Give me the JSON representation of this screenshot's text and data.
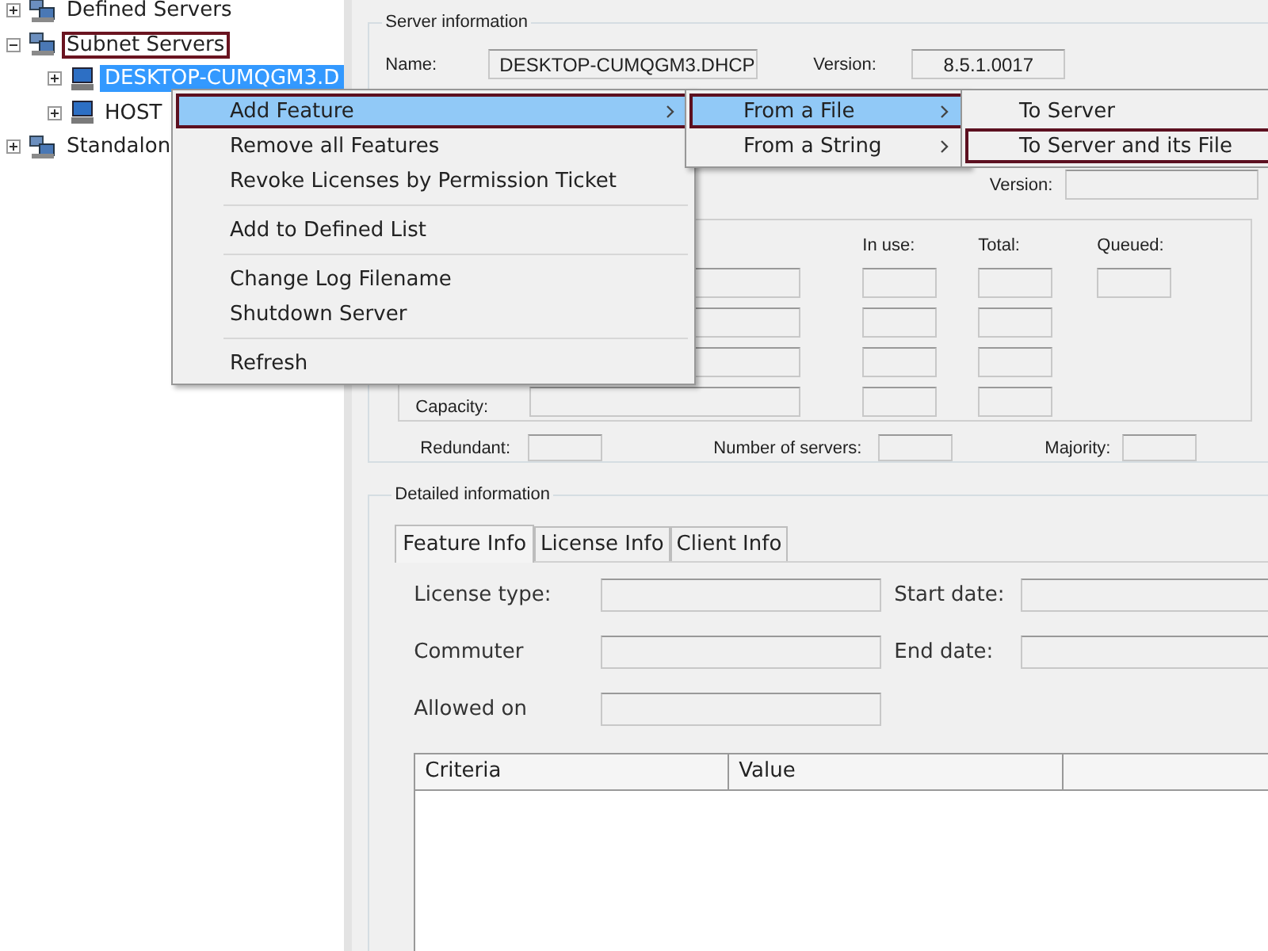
{
  "tree": [
    {
      "label": "Defined Servers",
      "kind": "group",
      "expanded": false,
      "selected": false,
      "annotated": false
    },
    {
      "label": "Subnet Servers",
      "kind": "group",
      "expanded": true,
      "selected": false,
      "annotated": true,
      "children": [
        {
          "label": "DESKTOP-CUMQGM3.D",
          "kind": "computer",
          "expanded": false,
          "selected": true,
          "annotated": false
        },
        {
          "label": "HOST",
          "kind": "computer",
          "expanded": false,
          "selected": false,
          "annotated": false
        }
      ]
    },
    {
      "label": "Standalon",
      "kind": "group",
      "expanded": false,
      "selected": false,
      "annotated": false
    }
  ],
  "server_information": {
    "title": "Server information",
    "name_label": "Name:",
    "name_value": "DESKTOP-CUMQGM3.DHCP",
    "version_label": "Version:",
    "version_value": "8.5.1.0017",
    "second_version_label": "Version:",
    "usage": {
      "columns": [
        "In use:",
        "Total:",
        "Queued:"
      ],
      "capacity_label": "Capacity:"
    },
    "redundant_label": "Redundant:",
    "number_of_servers_label": "Number of servers:",
    "majority_label": "Majority:"
  },
  "detailed_information": {
    "title": "Detailed information",
    "tabs": [
      {
        "label": "Feature Info",
        "selected": true
      },
      {
        "label": "License Info",
        "selected": false
      },
      {
        "label": "Client Info",
        "selected": false
      }
    ],
    "fields": [
      {
        "label": "License type:"
      },
      {
        "label": "Start date:"
      },
      {
        "label": "Commuter"
      },
      {
        "label": "End date:"
      },
      {
        "label": "Allowed on"
      }
    ],
    "table": {
      "columns": [
        "Criteria",
        "Value"
      ]
    }
  },
  "context_menu": [
    {
      "kind": "item",
      "label": "Add Feature",
      "highlighted": true,
      "annotated": true,
      "submenu": true
    },
    {
      "kind": "item",
      "label": "Remove all Features",
      "highlighted": false,
      "annotated": false,
      "submenu": false
    },
    {
      "kind": "item",
      "label": "Revoke Licenses by Permission Ticket",
      "highlighted": false,
      "annotated": false,
      "submenu": false
    },
    {
      "kind": "separator"
    },
    {
      "kind": "item",
      "label": "Add to Defined List",
      "highlighted": false,
      "annotated": false,
      "submenu": false
    },
    {
      "kind": "separator"
    },
    {
      "kind": "item",
      "label": "Change Log Filename",
      "highlighted": false,
      "annotated": false,
      "submenu": false
    },
    {
      "kind": "item",
      "label": "Shutdown Server",
      "highlighted": false,
      "annotated": false,
      "submenu": false
    },
    {
      "kind": "separator"
    },
    {
      "kind": "item",
      "label": "Refresh",
      "highlighted": false,
      "annotated": false,
      "submenu": false
    }
  ],
  "submenu": [
    {
      "kind": "item",
      "label": "From a File",
      "highlighted": true,
      "annotated": true,
      "submenu": true
    },
    {
      "kind": "item",
      "label": "From a String",
      "highlighted": false,
      "annotated": false,
      "submenu": true
    }
  ],
  "sub_submenu": [
    {
      "kind": "item",
      "label": "To Server",
      "highlighted": false,
      "annotated": false,
      "submenu": false
    },
    {
      "kind": "item",
      "label": "To Server and its File",
      "highlighted": false,
      "annotated": true,
      "submenu": false
    }
  ]
}
